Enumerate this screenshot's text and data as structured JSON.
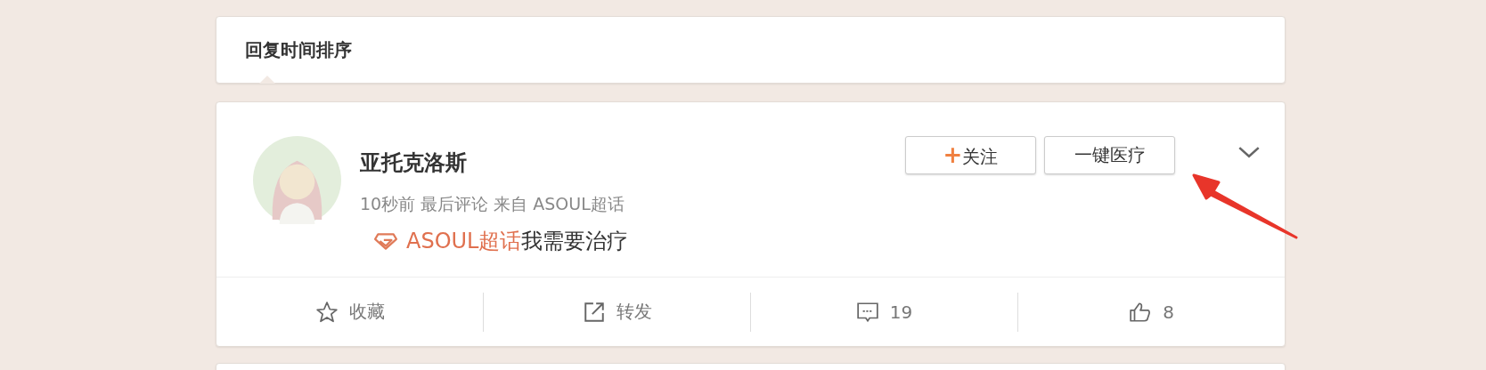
{
  "sort_tabs": [
    {
      "label": "回复时间排序",
      "selected": true
    }
  ],
  "post": {
    "author": "亚托克洛斯",
    "meta": "10秒前 最后评论 来自 ASOUL超话",
    "topic": "ASOUL超话",
    "text": "我需要治疗",
    "buttons": [
      {
        "kind": "follow",
        "plus": "+",
        "label": "关注"
      },
      {
        "kind": "plain",
        "label": "一键医疗"
      }
    ],
    "actions": [
      {
        "kind": "favorite",
        "label": "收藏"
      },
      {
        "kind": "repost",
        "label": "转发"
      },
      {
        "kind": "comment",
        "label": "19"
      },
      {
        "kind": "like",
        "label": "8"
      }
    ]
  }
}
